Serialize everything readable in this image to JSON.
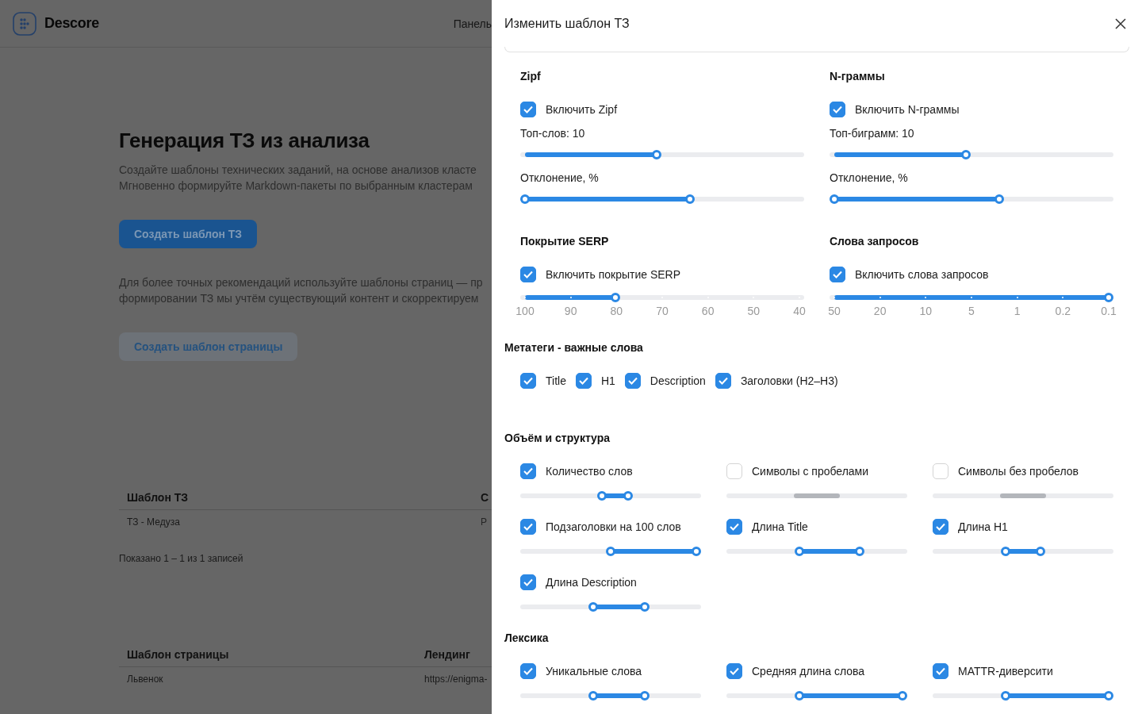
{
  "app": {
    "logo_text": "Descore",
    "nav_item": "Панель"
  },
  "page": {
    "title": "Генерация ТЗ из анализа",
    "description_lines": [
      "Создайте шаблоны технических заданий, на основе анализов класте",
      "Мгновенно формируйте Markdown-пакеты по выбранным кластерам"
    ],
    "primary_button": "Создать шаблон ТЗ",
    "note_lines": [
      "Для более точных рекомендаций используйте шаблоны страниц — пр",
      "формировании ТЗ мы учтём существующий контент и скорректируем"
    ],
    "secondary_button": "Создать шаблон страницы"
  },
  "tables": [
    {
      "columns": [
        "Шаблон ТЗ",
        "С"
      ],
      "rows": [
        [
          "ТЗ - Медуза",
          "Р"
        ]
      ],
      "footer": "Показано 1 – 1 из 1 записей"
    },
    {
      "columns": [
        "Шаблон страницы",
        "Лендинг"
      ],
      "rows": [
        [
          "Львенок",
          "https://enigma-"
        ]
      ]
    }
  ],
  "drawer": {
    "title": "Изменить шаблон ТЗ",
    "top_sections": [
      {
        "title": "Zipf",
        "toggle": {
          "label": "Включить Zipf",
          "checked": true
        },
        "sliders": [
          {
            "kind": "single",
            "label": "Топ-слов: 10",
            "level": 0.48
          },
          {
            "kind": "range",
            "label": "Отклонение, %",
            "low": {
              "level": 0
            },
            "high": {
              "level": 0.6
            }
          }
        ]
      },
      {
        "title": "N-граммы",
        "toggle": {
          "label": "Включить N-граммы",
          "checked": true
        },
        "sliders": [
          {
            "kind": "single",
            "label": "Топ-биграмм: 10",
            "level": 0.48
          },
          {
            "kind": "range",
            "label": "Отклонение, %",
            "low": {
              "level": 0
            },
            "high": {
              "level": 0.6
            }
          }
        ]
      },
      {
        "title": "Покрытие SERP",
        "toggle": {
          "label": "Включить покрытие SERP",
          "checked": true
        },
        "sliders": [
          {
            "kind": "ticked",
            "level": 0.33,
            "ticks": [
              "100",
              "90",
              "80",
              "70",
              "60",
              "50",
              "40"
            ]
          }
        ]
      },
      {
        "title": "Слова запросов",
        "toggle": {
          "label": "Включить слова запросов",
          "checked": true
        },
        "sliders": [
          {
            "kind": "ticked",
            "level": 1,
            "ticks": [
              "50",
              "20",
              "10",
              "5",
              "1",
              "0.2",
              "0.1"
            ]
          }
        ]
      }
    ],
    "metatags": {
      "title": "Метатеги - важные слова",
      "items": [
        {
          "label": "Title",
          "checked": true
        },
        {
          "label": "H1",
          "checked": true
        },
        {
          "label": "Description",
          "checked": true
        },
        {
          "label": "Заголовки (H2–H3)",
          "checked": true
        }
      ]
    },
    "grid_sections": [
      {
        "title": "Объём и структура",
        "items": [
          {
            "label": "Количество слов",
            "checked": true,
            "low": {
              "level": 0.45
            },
            "high": {
              "level": 0.6
            }
          },
          {
            "label": "Символы с пробелами",
            "checked": false,
            "low": {
              "level": 0.38
            },
            "high": {
              "level": 0.62
            }
          },
          {
            "label": "Символы без пробелов",
            "checked": false,
            "low": {
              "level": 0.38
            },
            "high": {
              "level": 0.62
            }
          },
          {
            "label": "Подзаголовки на 100 слов",
            "checked": true,
            "low": {
              "level": 0.5
            },
            "high": {
              "level": 1
            }
          },
          {
            "label": "Длина Title",
            "checked": true,
            "low": {
              "level": 0.4
            },
            "high": {
              "level": 0.75
            }
          },
          {
            "label": "Длина H1",
            "checked": true,
            "low": {
              "level": 0.4
            },
            "high": {
              "level": 0.6
            }
          },
          {
            "label": "Длина Description",
            "checked": true,
            "low": {
              "level": 0.4
            },
            "high": {
              "level": 0.7
            }
          }
        ]
      },
      {
        "title": "Лексика",
        "items": [
          {
            "label": "Уникальные слова",
            "checked": true,
            "low": {
              "level": 0.4
            },
            "high": {
              "level": 0.7
            }
          },
          {
            "label": "Средняя длина слова",
            "checked": true,
            "low": {
              "level": 0.4
            },
            "high": {
              "level": 1
            }
          },
          {
            "label": "MATTR-диверсити",
            "checked": true,
            "low": {
              "level": 0.4
            },
            "high": {
              "level": 1
            }
          }
        ]
      }
    ]
  }
}
